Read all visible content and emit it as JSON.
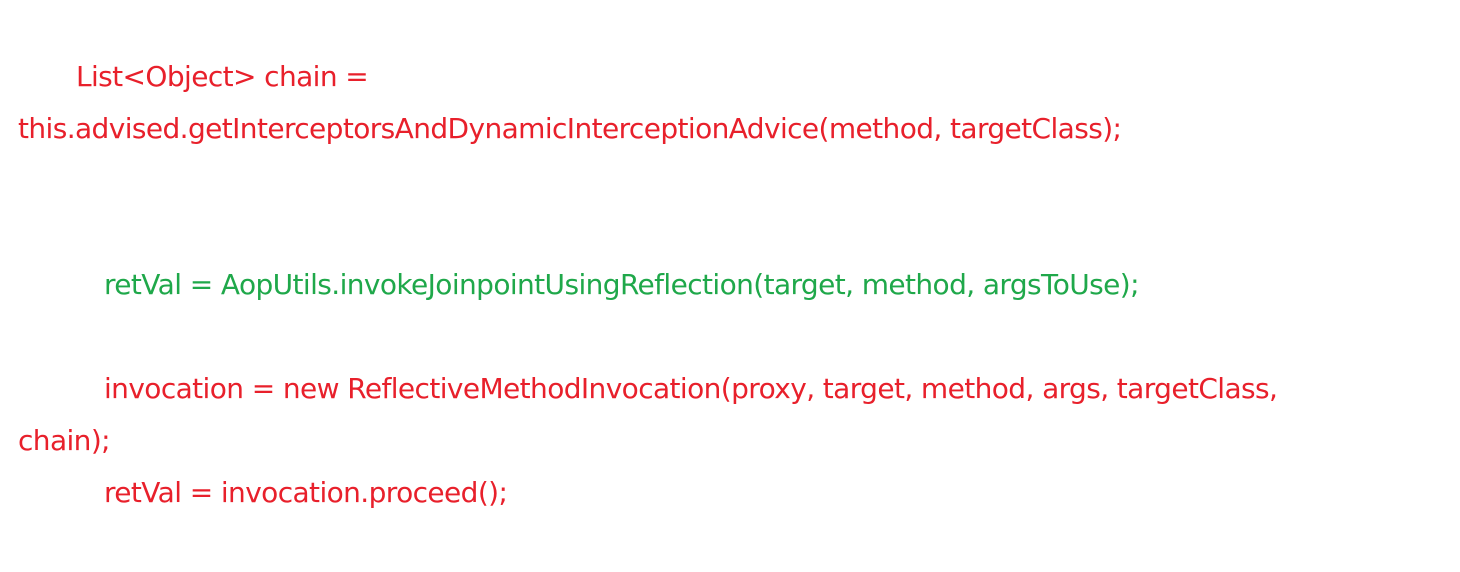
{
  "code": {
    "line1": "List<Object> chain =",
    "line2": "this.advised.getInterceptorsAndDynamicInterceptionAdvice(method, targetClass);",
    "line3": "retVal = AopUtils.invokeJoinpointUsingReflection(target, method, argsToUse);",
    "line4": "invocation = new ReflectiveMethodInvocation(proxy, target, method, args, targetClass,",
    "line5": "chain);",
    "line6": "retVal = invocation.proceed();"
  },
  "colors": {
    "red": "#e8202b",
    "green": "#1fa84a"
  }
}
